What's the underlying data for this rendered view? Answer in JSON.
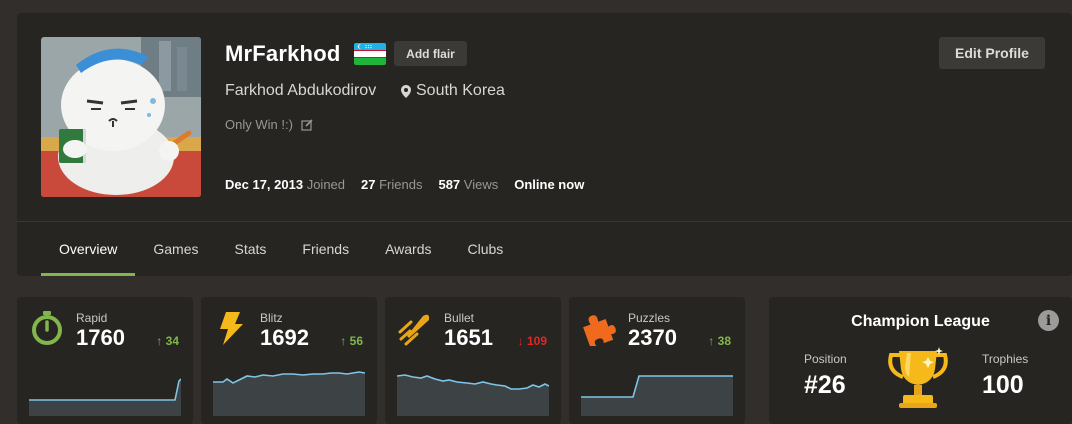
{
  "profile": {
    "username": "MrFarkhod",
    "flair_button": "Add flair",
    "edit_button": "Edit Profile",
    "full_name": "Farkhod Abdukodirov",
    "location": "South Korea",
    "status": "Only Win !:)",
    "joined_date": "Dec 17, 2013",
    "joined_label": "Joined",
    "friends_count": "27",
    "friends_label": "Friends",
    "views_count": "587",
    "views_label": "Views",
    "online_status": "Online now"
  },
  "tabs": [
    {
      "label": "Overview",
      "active": true
    },
    {
      "label": "Games"
    },
    {
      "label": "Stats"
    },
    {
      "label": "Friends"
    },
    {
      "label": "Awards"
    },
    {
      "label": "Clubs"
    }
  ],
  "stats": [
    {
      "label": "Rapid",
      "value": "1760",
      "change": "34",
      "direction": "up",
      "icon": "stopwatch-icon"
    },
    {
      "label": "Blitz",
      "value": "1692",
      "change": "56",
      "direction": "up",
      "icon": "lightning-icon"
    },
    {
      "label": "Bullet",
      "value": "1651",
      "change": "109",
      "direction": "down",
      "icon": "bullet-icon"
    },
    {
      "label": "Puzzles",
      "value": "2370",
      "change": "38",
      "direction": "up",
      "icon": "puzzle-piece-icon"
    }
  ],
  "league": {
    "title": "Champion League",
    "position_label": "Position",
    "position_value": "#26",
    "trophies_label": "Trophies",
    "trophies_value": "100",
    "info_icon": "info-icon",
    "trophy_icon": "trophy-icon"
  },
  "colors": {
    "page_bg": "#312e2b",
    "card_bg": "#262522",
    "accent_green": "#81b64c",
    "down_red": "#e02828",
    "sparkline": "#7fc5e8",
    "trophy_gold": "#f6b91a"
  }
}
